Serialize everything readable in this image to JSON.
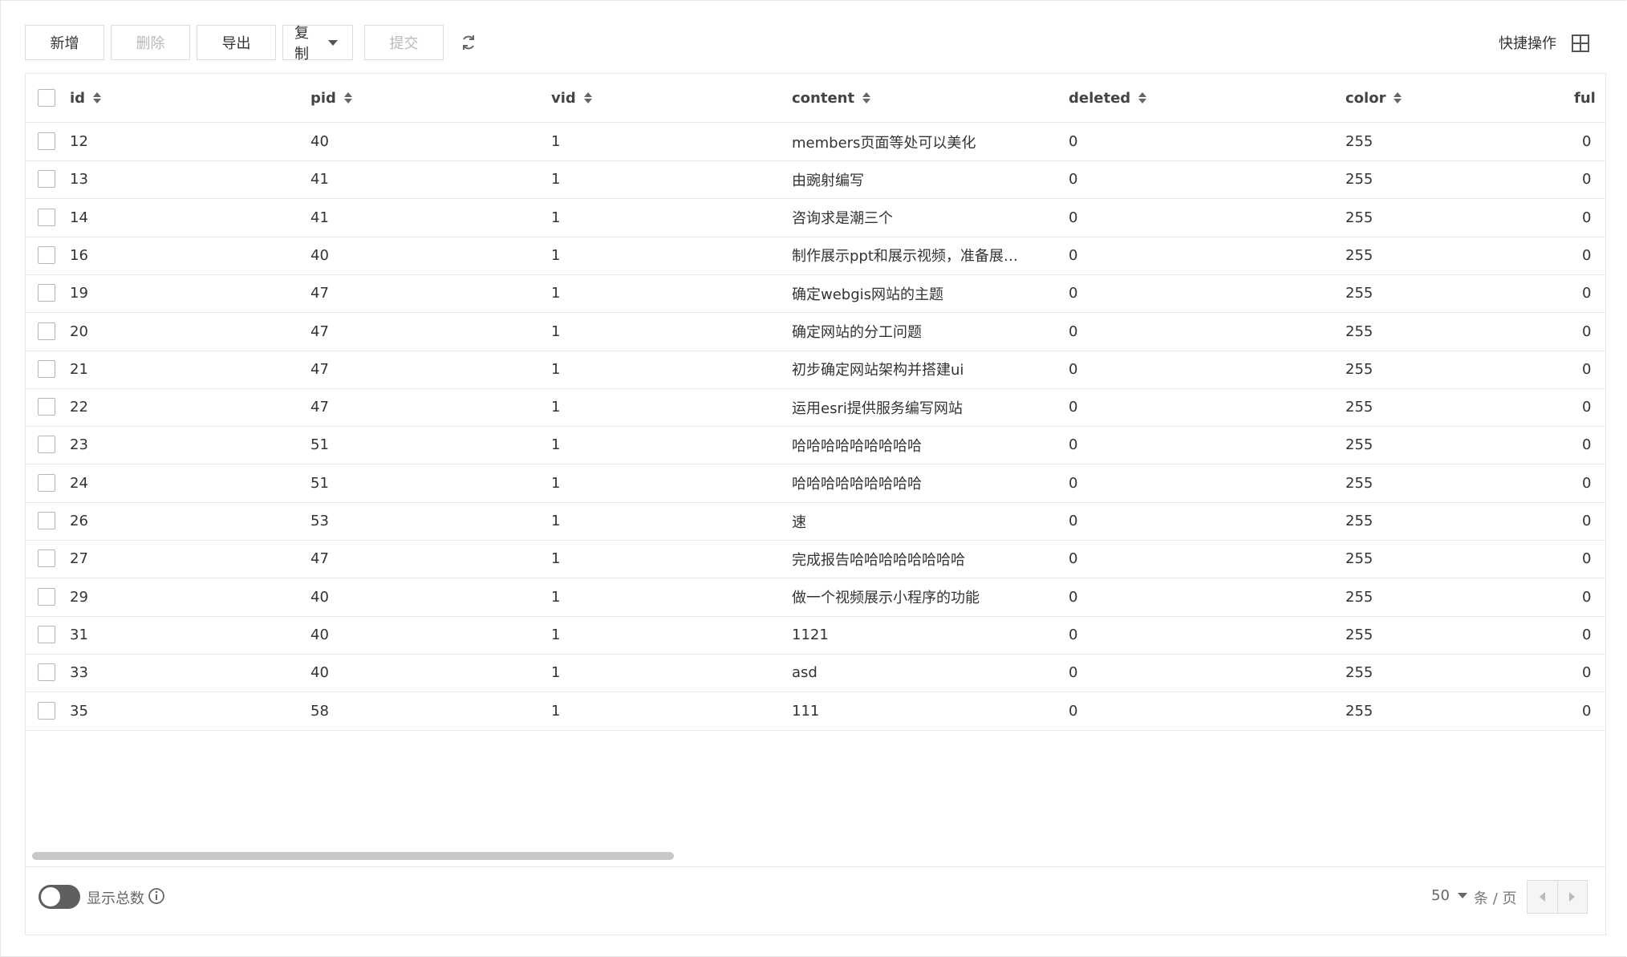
{
  "toolbar": {
    "add_label": "新增",
    "delete_label": "删除",
    "export_label": "导出",
    "copy_label": "复制",
    "submit_label": "提交"
  },
  "quick_actions_label": "快捷操作",
  "table": {
    "columns": [
      "id",
      "pid",
      "vid",
      "content",
      "deleted",
      "color",
      "ful"
    ],
    "rows": [
      [
        "12",
        "40",
        "1",
        "members页面等处可以美化",
        "0",
        "255",
        "0"
      ],
      [
        "13",
        "41",
        "1",
        "由豌射编写",
        "0",
        "255",
        "0"
      ],
      [
        "14",
        "41",
        "1",
        "咨询求是潮三个",
        "0",
        "255",
        "0"
      ],
      [
        "16",
        "40",
        "1",
        "制作展示ppt和展示视频，准备展…",
        "0",
        "255",
        "0"
      ],
      [
        "19",
        "47",
        "1",
        "确定webgis网站的主题",
        "0",
        "255",
        "0"
      ],
      [
        "20",
        "47",
        "1",
        "确定网站的分工问题",
        "0",
        "255",
        "0"
      ],
      [
        "21",
        "47",
        "1",
        "初步确定网站架构并搭建ui",
        "0",
        "255",
        "0"
      ],
      [
        "22",
        "47",
        "1",
        "运用esri提供服务编写网站",
        "0",
        "255",
        "0"
      ],
      [
        "23",
        "51",
        "1",
        "哈哈哈哈哈哈哈哈哈",
        "0",
        "255",
        "0"
      ],
      [
        "24",
        "51",
        "1",
        "哈哈哈哈哈哈哈哈哈",
        "0",
        "255",
        "0"
      ],
      [
        "26",
        "53",
        "1",
        "速",
        "0",
        "255",
        "0"
      ],
      [
        "27",
        "47",
        "1",
        "完成报告哈哈哈哈哈哈哈哈",
        "0",
        "255",
        "0"
      ],
      [
        "29",
        "40",
        "1",
        "做一个视频展示小程序的功能",
        "0",
        "255",
        "0"
      ],
      [
        "31",
        "40",
        "1",
        "1121",
        "0",
        "255",
        "0"
      ],
      [
        "33",
        "40",
        "1",
        "asd",
        "0",
        "255",
        "0"
      ],
      [
        "35",
        "58",
        "1",
        "111",
        "0",
        "255",
        "0"
      ]
    ]
  },
  "footer": {
    "show_total_label": "显示总数",
    "page_size": "50",
    "per_page_label": "条 / 页"
  }
}
